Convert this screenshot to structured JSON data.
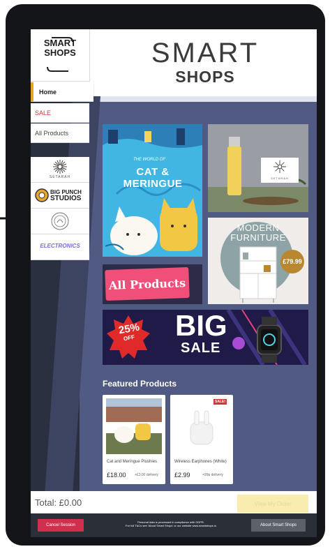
{
  "app": {
    "logo_line1": "SMART",
    "logo_line2": "SHOPS",
    "brand_line1": "SMART",
    "brand_line2": "SHOPS"
  },
  "nav": {
    "items": [
      {
        "label": "Home",
        "active": true
      },
      {
        "label": "SALE",
        "color": "#d6323a"
      },
      {
        "label": "All Products"
      }
    ]
  },
  "brands": [
    {
      "name": "SETARAH",
      "icon": "sunburst-icon"
    },
    {
      "name_line1": "BIG PUNCH",
      "name_line2": "STUDIOS",
      "icon": "boxing-glove-icon"
    },
    {
      "name": "",
      "icon": "circle-logo-icon"
    },
    {
      "name": "ELECTRONICS",
      "icon": "lightning-icon"
    }
  ],
  "tiles": {
    "cat": {
      "top_text": "THE WORLD OF",
      "title": "CAT & MERINGUE"
    },
    "serum": {
      "brand": "SETARAH"
    },
    "furniture": {
      "line1": "MODERN",
      "line2": "FURNITURE",
      "price": "£79.99"
    },
    "all_products": {
      "label": "All Products"
    },
    "sale": {
      "percent": "25%",
      "off": "OFF",
      "big": "BIG",
      "sale": "SALE"
    }
  },
  "featured": {
    "title": "Featured Products",
    "products": [
      {
        "name": "Cat and Meringue Plushies",
        "price": "£18.00",
        "delivery": "+£3.00 delivery",
        "badge": ""
      },
      {
        "name": "Wireless Earphones (White)",
        "price": "£2.99",
        "delivery": "+99p delivery",
        "badge": "SALE!"
      }
    ]
  },
  "footer": {
    "total": "Total: £0.00",
    "view_order": "View My Order",
    "cancel": "Cancel Session",
    "gdpr_line1": "Personal data is processed in compliance with GDPR.",
    "gdpr_line2": "For full T&Cs see 'About Smart Shops' or our website www.smartshops.io",
    "about": "About Smart Shops"
  },
  "colors": {
    "main_bg": "#515a83",
    "nav_active_accent": "#e5a722",
    "cancel_button": "#d0304e",
    "view_order_button": "#f8ecaf",
    "bottom_bar": "#2b2f38"
  }
}
